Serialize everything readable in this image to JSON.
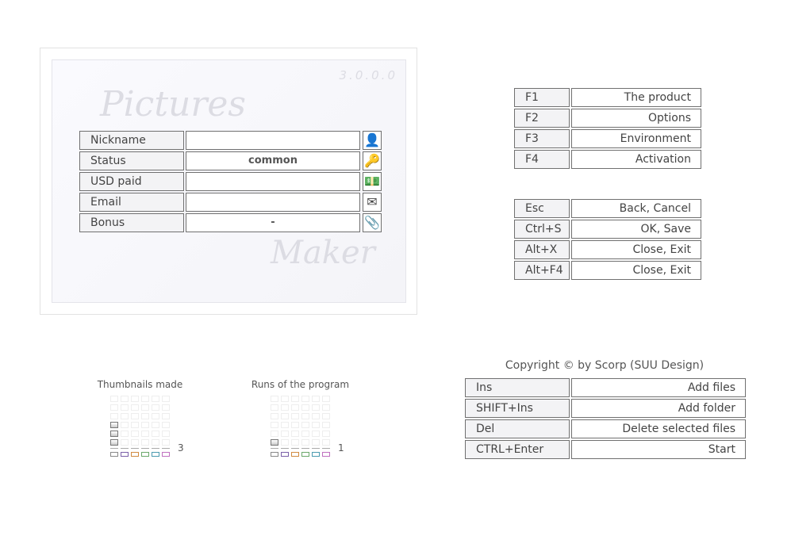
{
  "version": "3.0.0.0",
  "watermark": [
    "Pictures",
    "Maker"
  ],
  "profile": [
    {
      "label": "Nickname",
      "value": "",
      "icon": "user-icon"
    },
    {
      "label": "Status",
      "value": "common",
      "icon": "key-icon"
    },
    {
      "label": "USD paid",
      "value": "",
      "icon": "money-icon"
    },
    {
      "label": "Email",
      "value": "",
      "icon": "envelope-icon"
    },
    {
      "label": "Bonus",
      "value": "-",
      "icon": "paperclip-icon"
    }
  ],
  "hotkeys_top": [
    [
      "F1",
      "The product"
    ],
    [
      "F2",
      "Options"
    ],
    [
      "F3",
      "Environment"
    ],
    [
      "F4",
      "Activation"
    ]
  ],
  "hotkeys_mid": [
    [
      "Esc",
      "Back, Cancel"
    ],
    [
      "Ctrl+S",
      "OK, Save"
    ],
    [
      "Alt+X",
      "Close, Exit"
    ],
    [
      "Alt+F4",
      "Close, Exit"
    ]
  ],
  "copyright": "Copyright © by Scorp (SUU Design)",
  "hotkeys_bottom": [
    [
      "Ins",
      "Add files"
    ],
    [
      "SHIFT+Ins",
      "Add folder"
    ],
    [
      "Del",
      "Delete selected files"
    ],
    [
      "CTRL+Enter",
      "Start"
    ]
  ],
  "stats": [
    {
      "title": "Thumbnails made",
      "count": "3",
      "value": 3
    },
    {
      "title": "Runs of the program",
      "count": "1",
      "value": 1
    }
  ],
  "bar_colors": [
    "#888888",
    "#7a5fa8",
    "#d08a40",
    "#6aa86a",
    "#4a9ab0",
    "#c070c0"
  ]
}
